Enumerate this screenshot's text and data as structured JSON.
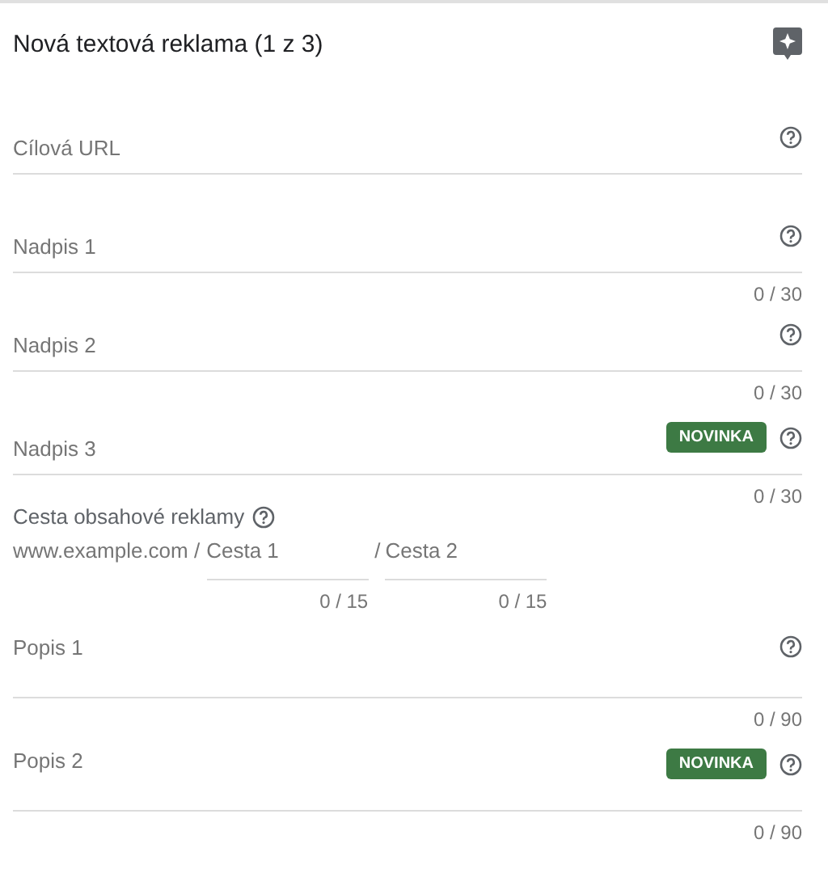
{
  "header": {
    "title": "Nová textová reklama (1 z 3)"
  },
  "fields": [
    {
      "kind": "text",
      "placeholder": "Cílová URL"
    },
    {
      "kind": "text",
      "placeholder": "Nadpis 1",
      "counter": "0 / 30"
    },
    {
      "kind": "text",
      "placeholder": "Nadpis 2",
      "counter": "0 / 30"
    },
    {
      "kind": "text",
      "placeholder": "Nadpis 3",
      "badge": "NOVINKA",
      "counter": "0 / 30"
    },
    {
      "kind": "path",
      "label": "Cesta obsahové reklamy",
      "domain": "www.example.com /",
      "paths": [
        {
          "placeholder": "Cesta 1",
          "counter": "0 / 15"
        },
        {
          "separator": "/",
          "placeholder": "Cesta 2",
          "counter": "0 / 15"
        }
      ]
    },
    {
      "kind": "textarea",
      "placeholder": "Popis 1",
      "counter": "0 / 90"
    },
    {
      "kind": "textarea",
      "placeholder": "Popis 2",
      "badge": "NOVINKA",
      "counter": "0 / 90"
    }
  ]
}
